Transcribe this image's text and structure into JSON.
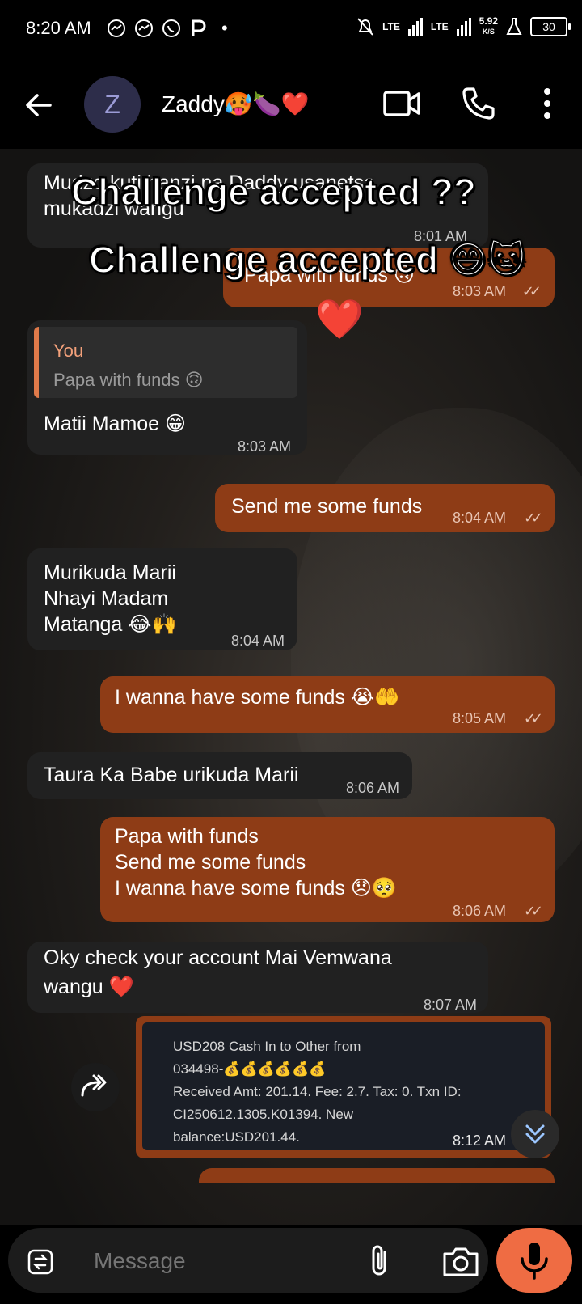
{
  "status_bar": {
    "time": "8:20 AM",
    "dot": "•",
    "net_label_1": "LTE",
    "net_label_2": "LTE",
    "speed": "5.92",
    "speed_unit": "K/S",
    "battery": "30"
  },
  "header": {
    "avatar_letter": "Z",
    "contact_name": "Zaddy🥵🍆❤️"
  },
  "overlay": {
    "line1": "Challenge accepted ??",
    "line2": "Challenge accepted 😄🐱",
    "heart": "❤️"
  },
  "messages": [
    {
      "dir": "in",
      "text": "Mudzo kuti hanzi na Daddy usanetsa\nmukadzi wangu",
      "time": "8:01 AM"
    },
    {
      "dir": "out",
      "text": "Papa with funds 🙃",
      "time": "8:03 AM"
    },
    {
      "dir": "in",
      "reply_author": "You",
      "reply_text": "Papa with funds 🙃",
      "text": "Matii Mamoe 😁",
      "time": "8:03 AM"
    },
    {
      "dir": "out",
      "text": "Send me some funds",
      "time": "8:04 AM"
    },
    {
      "dir": "in",
      "text": "Murikuda Marii\nNhayi Madam\nMatanga 😂🙌",
      "time": "8:04 AM"
    },
    {
      "dir": "out",
      "text": "I wanna have some funds 😭🤲",
      "time": "8:05 AM"
    },
    {
      "dir": "in",
      "text": "Taura Ka Babe urikuda Marii",
      "time": "8:06 AM"
    },
    {
      "dir": "out",
      "text": "Papa with funds\nSend me some funds\nI wanna have some funds 😞🥺",
      "time": "8:06 AM"
    },
    {
      "dir": "in",
      "text": "Oky check your account Mai Vemwana\nwangu ❤️",
      "time": "8:07 AM"
    },
    {
      "dir": "out",
      "receipt_text": "USD208 Cash In to Other from\n034498-💰💰💰💰💰💰\nReceived Amt: 201.14. Fee: 2.7. Tax: 0. Txn ID:\nCI250612.1305.K01394. New\nbalance:USD201.44.",
      "time": "8:12 AM"
    }
  ],
  "ticks": "✓✓",
  "input": {
    "placeholder": "Message"
  },
  "colors": {
    "outgoing_bubble": "#8e3c16",
    "incoming_bubble": "#212121",
    "mic_button": "#ef6c43"
  }
}
